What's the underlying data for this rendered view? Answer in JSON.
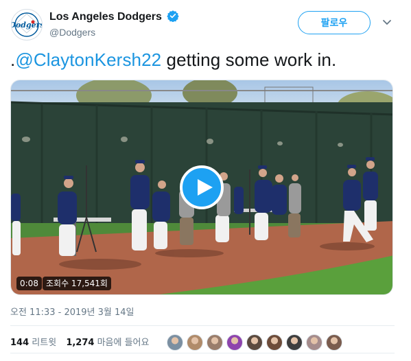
{
  "header": {
    "account_name": "Los Angeles Dodgers",
    "handle": "@Dodgers",
    "follow_label": "팔로우",
    "avatar_text": "Dodgers"
  },
  "tweet": {
    "prefix": ".",
    "mention": "@ClaytonKersh22",
    "text": " getting some work in."
  },
  "video": {
    "duration": "0:08",
    "views": "조회수 17,541회"
  },
  "timestamp": "오전 11:33 - 2019년 3월 14일",
  "stats": {
    "retweets_count": "144",
    "retweets_label": "리트윗",
    "likes_count": "1,274",
    "likes_label": "마음에 들어요"
  },
  "likers": [
    {
      "name": "liker-avatar-1",
      "color": "#7b8fa1"
    },
    {
      "name": "liker-avatar-2",
      "color": "#b08b6a"
    },
    {
      "name": "liker-avatar-3",
      "color": "#9a7d6b"
    },
    {
      "name": "liker-avatar-4",
      "color": "#8e44ad"
    },
    {
      "name": "liker-avatar-5",
      "color": "#5b4a3f"
    },
    {
      "name": "liker-avatar-6",
      "color": "#6d4c3a"
    },
    {
      "name": "liker-avatar-7",
      "color": "#3e3e3e"
    },
    {
      "name": "liker-avatar-8",
      "color": "#a58c8c"
    },
    {
      "name": "liker-avatar-9",
      "color": "#7a5c4e"
    }
  ],
  "colors": {
    "accent": "#1da1f2",
    "mention": "#1b95e0",
    "secondary_text": "#657786",
    "dodgers_blue": "#005a9c"
  }
}
